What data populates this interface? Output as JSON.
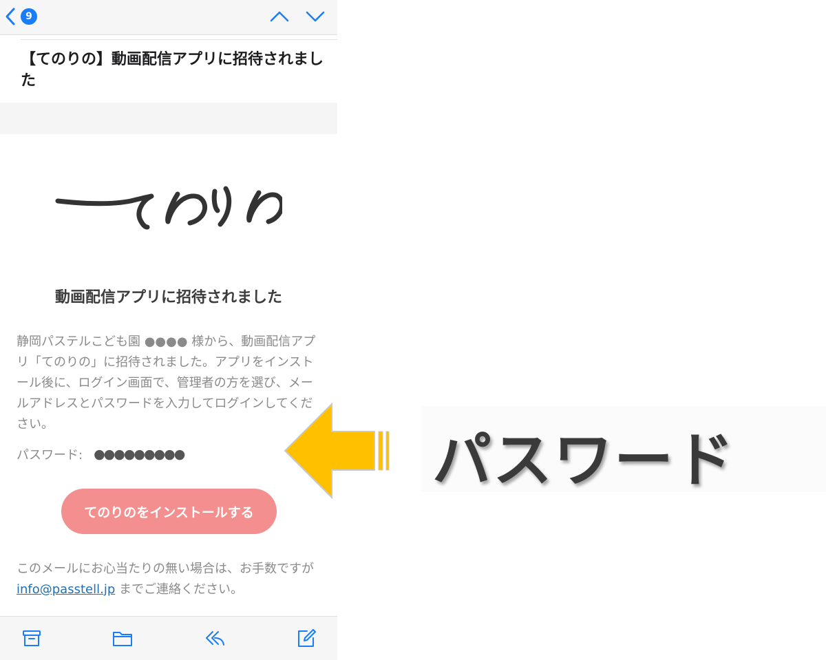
{
  "nav": {
    "unread_count": "9"
  },
  "email": {
    "subject": "【てのりの】動画配信アプリに招待されました",
    "logo_text": "てのりの",
    "heading": "動画配信アプリに招待されました",
    "body": "静岡パステルこども園 ●●●● 様から、動画配信アプリ「てのりの」に招待されました。アプリをインストール後に、ログイン画面で、管理者の方を選び、メールアドレスとパスワードを入力してログインしてください。",
    "password_label": "パスワード:",
    "password_value": "●●●●●●●●●",
    "install_button": "てのりのをインストールする",
    "footer_before": "このメールにお心当たりの無い場合は、お手数ですが ",
    "footer_link": "info@passtell.jp",
    "footer_after": " までご連絡ください。"
  },
  "annotation": {
    "label": "パスワード"
  },
  "colors": {
    "accent_blue": "#1a7cf6",
    "button_pink": "#f48f8f",
    "arrow_yellow": "#ffc000",
    "link": "#1e6fb4"
  },
  "icons": {
    "nav": [
      "chevron-left-icon",
      "chevron-up-icon",
      "chevron-down-icon"
    ],
    "toolbar": [
      "archive-icon",
      "folder-icon",
      "reply-icon",
      "compose-icon"
    ]
  }
}
